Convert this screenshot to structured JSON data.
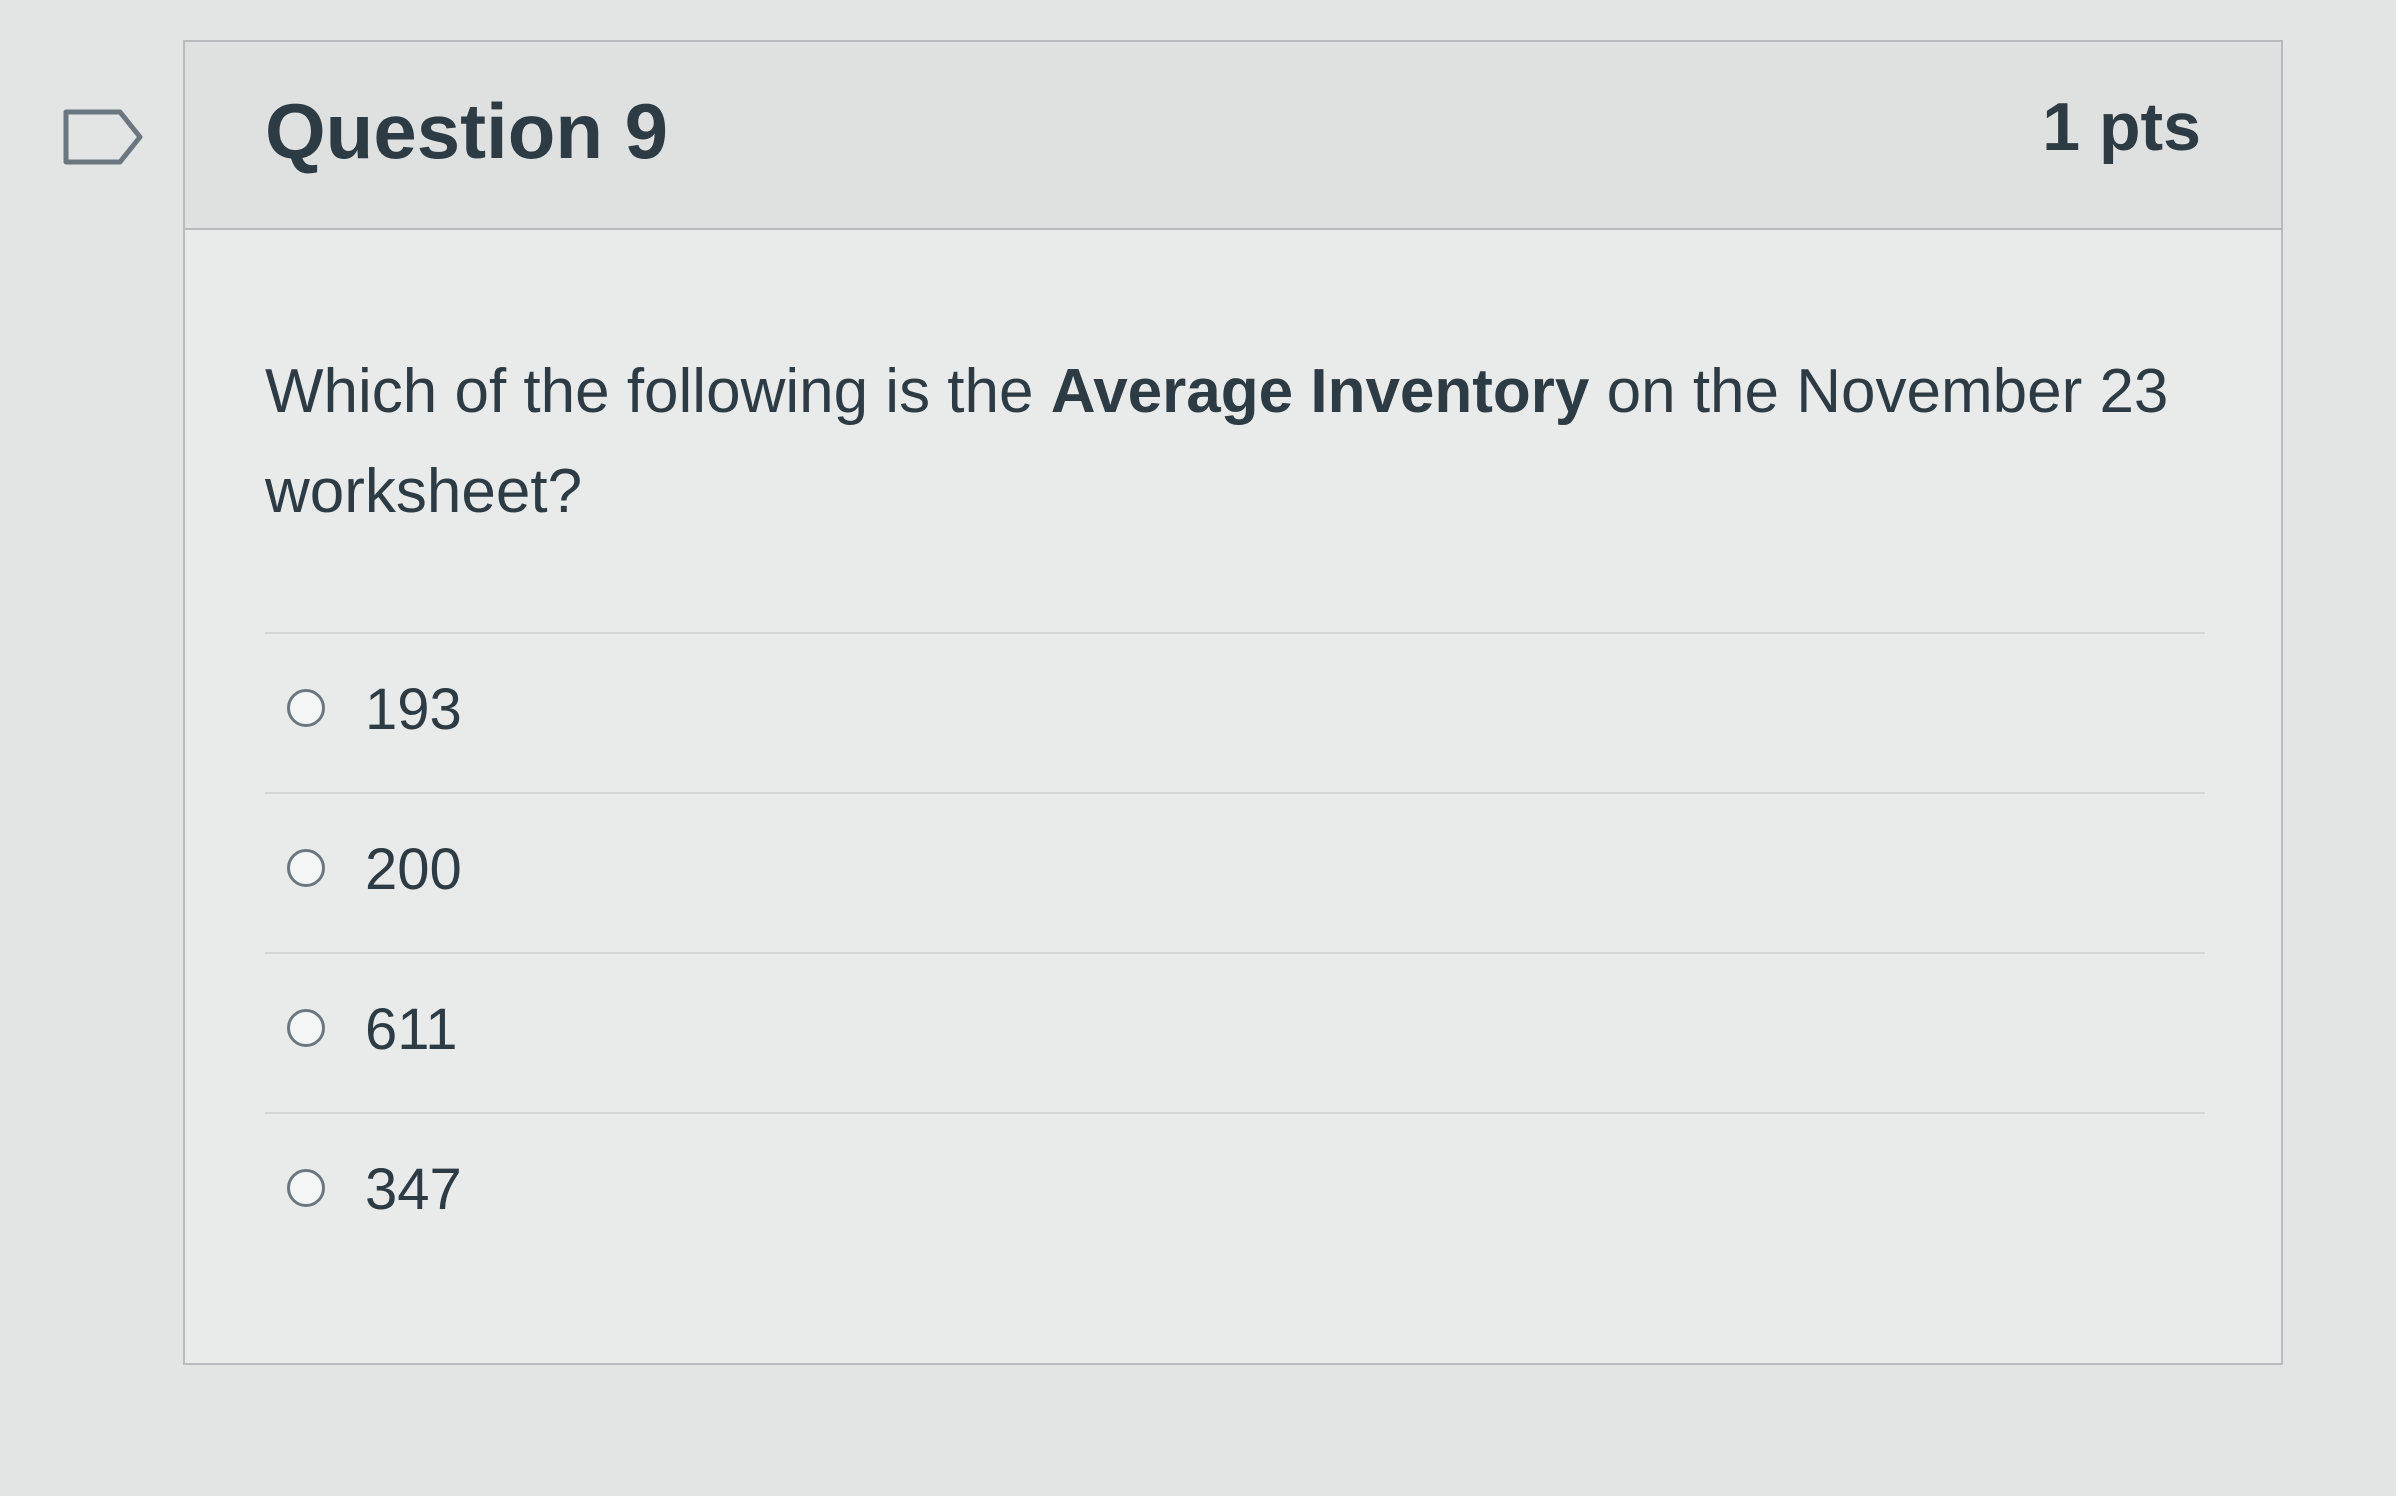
{
  "question": {
    "title": "Question 9",
    "points": "1 pts",
    "text_before": "Which of the following is the ",
    "text_bold": "Average Inventory",
    "text_after": " on the November 23 worksheet?",
    "flag_icon": "flag-outline-icon"
  },
  "answers": [
    {
      "label": "193",
      "selected": false
    },
    {
      "label": "200",
      "selected": false
    },
    {
      "label": "611",
      "selected": false
    },
    {
      "label": "347",
      "selected": false
    }
  ]
}
